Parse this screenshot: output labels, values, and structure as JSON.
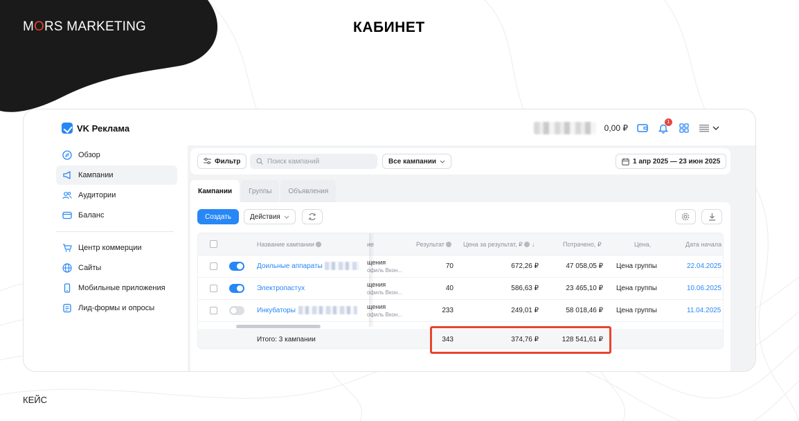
{
  "brand": {
    "before": "M",
    "o_letter": "O",
    "after": "RS MARKETING"
  },
  "heading": "КАБИНЕТ",
  "footer": "КЕЙС",
  "colors": {
    "accent": "#2787f5",
    "highlight": "#e8452c",
    "blob": "#1a1a1a"
  },
  "app": {
    "title": "VK Реклама",
    "balance": "0,00 ₽",
    "notification_count": "1"
  },
  "sidebar": {
    "items": [
      {
        "label": "Обзор",
        "icon": "compass-icon"
      },
      {
        "label": "Кампании",
        "icon": "megaphone-icon",
        "active": true
      },
      {
        "label": "Аудитории",
        "icon": "users-icon"
      },
      {
        "label": "Баланс",
        "icon": "wallet-icon"
      }
    ],
    "items2": [
      {
        "label": "Центр коммерции",
        "icon": "cart-icon"
      },
      {
        "label": "Сайты",
        "icon": "globe-icon"
      },
      {
        "label": "Мобильные приложения",
        "icon": "phone-icon"
      },
      {
        "label": "Лид-формы и опросы",
        "icon": "form-icon"
      }
    ]
  },
  "filterbar": {
    "filter_label": "Фильтр",
    "search_placeholder": "Поиск кампаний",
    "campaign_select": "Все кампании",
    "date_range": "1 апр 2025 — 23 июн 2025"
  },
  "tabs": [
    "Кампании",
    "Группы",
    "Объявления"
  ],
  "toolbar": {
    "create_label": "Создать",
    "actions_label": "Действия"
  },
  "table": {
    "headers": {
      "name": "Название кампании",
      "objective": "ие",
      "result": "Результат",
      "cpr": "Цена за результат, ₽",
      "spent": "Потрачено, ₽",
      "price": "Цена,",
      "start": "Дата начала"
    },
    "rows": [
      {
        "name": "Доильные аппараты",
        "enabled": true,
        "objective": "щения",
        "objective_sub": "офиль Вкон...",
        "result": "70",
        "cpr": "672,26 ₽",
        "spent": "47 058,05 ₽",
        "price": "Цена группы",
        "start": "22.04.2025"
      },
      {
        "name": "Электропастух",
        "enabled": true,
        "objective": "щения",
        "objective_sub": "офиль Вкон...",
        "result": "40",
        "cpr": "586,63 ₽",
        "spent": "23 465,10 ₽",
        "price": "Цена группы",
        "start": "10.06.2025"
      },
      {
        "name": "Инкубаторы",
        "enabled": false,
        "objective": "щения",
        "objective_sub": "офиль Вкон...",
        "result": "233",
        "cpr": "249,01 ₽",
        "spent": "58 018,46 ₽",
        "price": "Цена группы",
        "start": "11.04.2025"
      }
    ],
    "total": {
      "label": "Итого: 3 кампании",
      "result": "343",
      "cpr": "374,76 ₽",
      "spent": "128 541,61 ₽"
    }
  }
}
